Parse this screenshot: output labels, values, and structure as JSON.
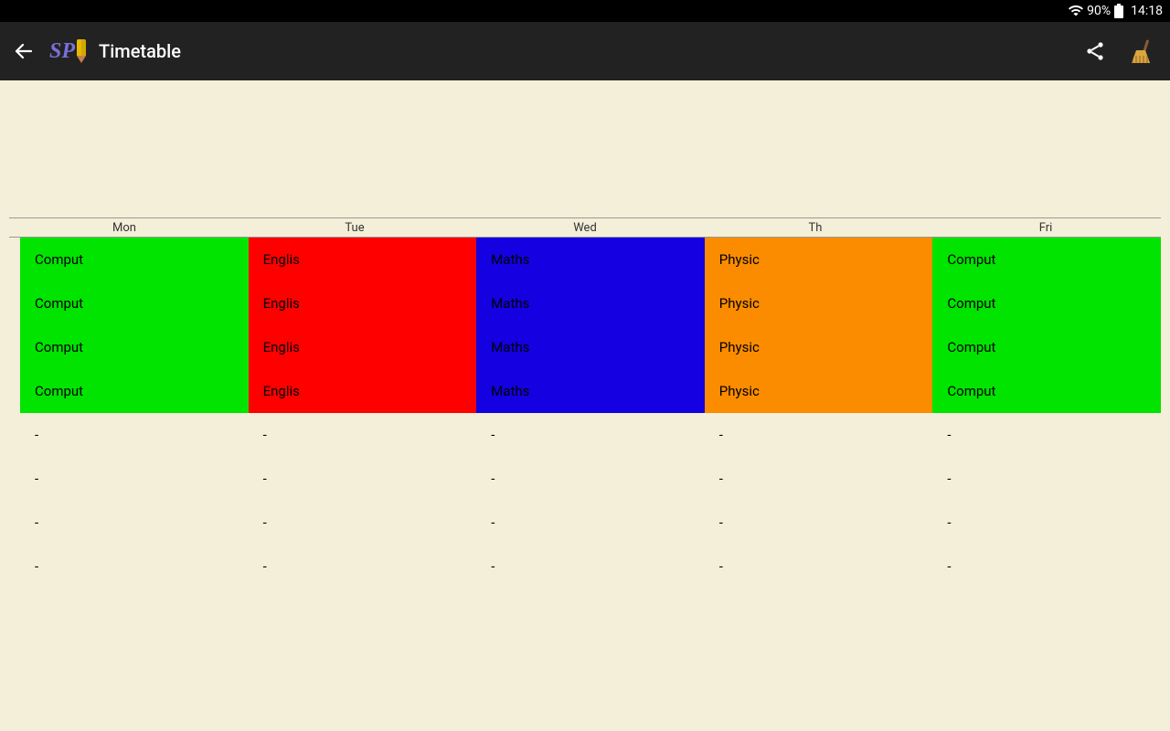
{
  "status": {
    "battery_pct": "90%",
    "time": "14:18"
  },
  "appbar": {
    "logo_text": "SP",
    "title": "Timetable"
  },
  "timetable": {
    "days": [
      "Mon",
      "Tue",
      "Wed",
      "Th",
      "Fri"
    ],
    "columns": [
      {
        "subject": "Comput",
        "color": "green"
      },
      {
        "subject": "Englis",
        "color": "red"
      },
      {
        "subject": "Maths",
        "color": "blue"
      },
      {
        "subject": "Physic",
        "color": "orange"
      },
      {
        "subject": "Comput",
        "color": "green"
      }
    ],
    "filled_rows": 4,
    "empty_rows": 4,
    "empty_placeholder": "-"
  }
}
